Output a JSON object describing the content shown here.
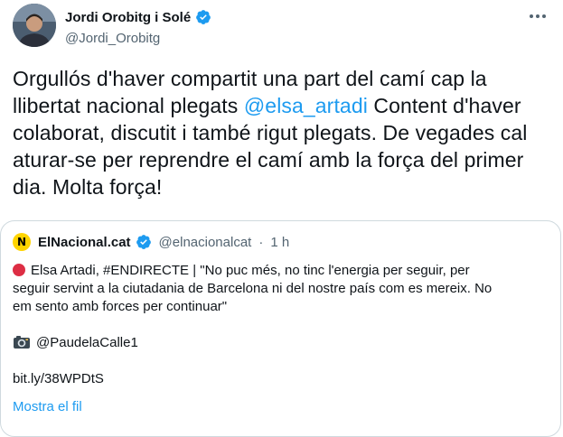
{
  "author": {
    "name": "Jordi Orobitg i Solé",
    "handle": "@Jordi_Orobitg"
  },
  "tweet": {
    "text_before": "Orgullós d'haver compartit una part del camí cap la llibertat nacional plegats ",
    "mention": "@elsa_artadi",
    "text_after": " Content d'haver colaborat, discutit i també rigut plegats. De vegades cal aturar-se per reprendre el camí amb la força del primer dia. Molta força!"
  },
  "quoted": {
    "logo_letter": "N",
    "name": "ElNacional.cat",
    "handle": "@elnacionalcat",
    "separator": "·",
    "time": "1 h",
    "line1": "Elsa Artadi, #ENDIRECTE | \"No puc més, no tinc l'energia per seguir, per",
    "line2": "seguir servint a la ciutadania de Barcelona ni del nostre país com es  mereix. No",
    "line3": "em sento amb forces per continuar\"",
    "photo_credit": "@PaudelaCalle1",
    "link": "bit.ly/38WPDtS",
    "show_thread": "Mostra el fil"
  },
  "icons": {
    "verified": "verified-badge-icon",
    "more": "more-icon",
    "red_circle": "red-circle-emoji",
    "camera": "camera-emoji"
  },
  "colors": {
    "link": "#1d9bf0",
    "verified": "#1d9bf0",
    "secondary_text": "#536471",
    "logo_bg": "#ffd400",
    "red_circle": "#dd2e44",
    "border": "#cfd9de"
  }
}
